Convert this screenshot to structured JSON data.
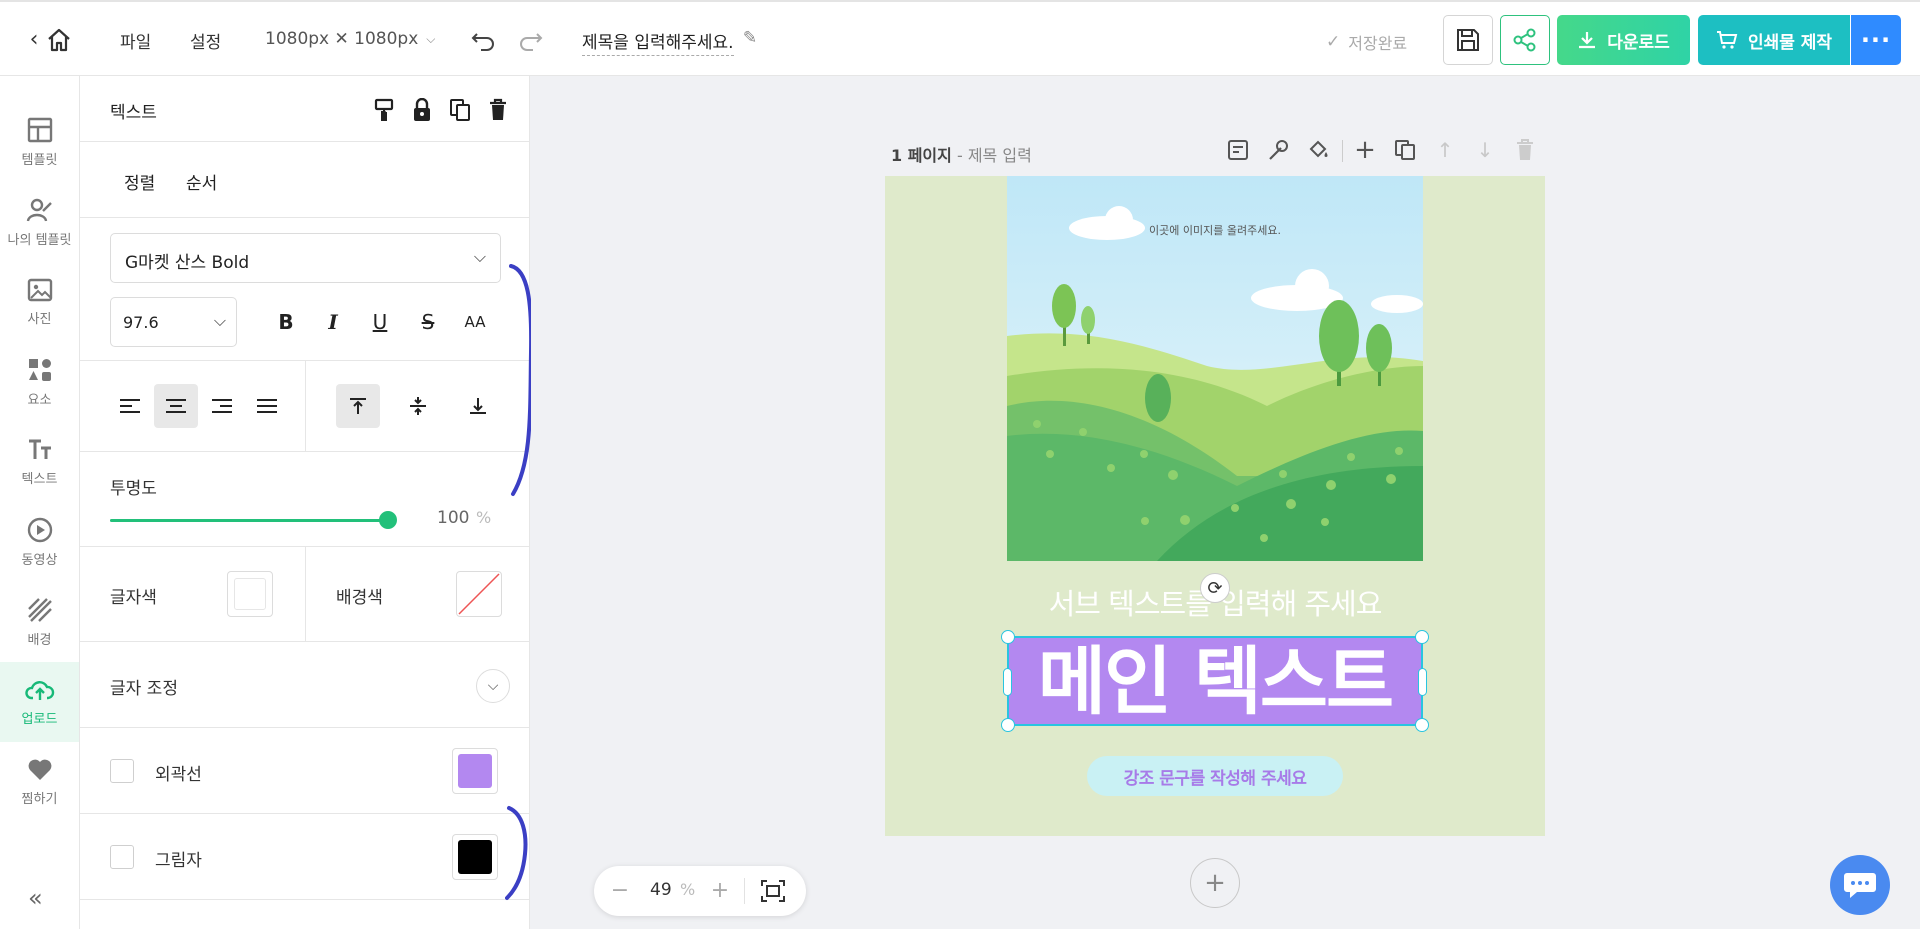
{
  "topbar": {
    "menu_file": "파일",
    "menu_settings": "설정",
    "size": "1080px ✕ 1080px",
    "title": "제목을 입력해주세요.",
    "save_status": "저장완료",
    "download_label": "다운로드",
    "print_label": "인쇄물 제작"
  },
  "leftnav": {
    "items": [
      {
        "label": "템플릿",
        "icon": "template-icon"
      },
      {
        "label": "나의 템플릿",
        "icon": "my-template-icon"
      },
      {
        "label": "사진",
        "icon": "photo-icon"
      },
      {
        "label": "요소",
        "icon": "elements-icon"
      },
      {
        "label": "텍스트",
        "icon": "text-icon"
      },
      {
        "label": "동영상",
        "icon": "video-icon"
      },
      {
        "label": "배경",
        "icon": "background-icon"
      },
      {
        "label": "업로드",
        "icon": "upload-icon"
      },
      {
        "label": "찜하기",
        "icon": "heart-icon"
      }
    ],
    "active": "업로드",
    "collapse": "«"
  },
  "panel": {
    "title": "텍스트",
    "tab_align": "정렬",
    "tab_order": "순서",
    "font": "G마켓 산스 Bold",
    "font_size": "97.6",
    "format_buttons": [
      "B",
      "I",
      "U",
      "S",
      "AA"
    ],
    "opacity_label": "투명도",
    "opacity_value": "100",
    "opacity_unit": "%",
    "opacity_fraction": 1.0,
    "text_color_label": "글자색",
    "bg_color_label": "배경색",
    "text_adjust_label": "글자 조정",
    "outline_label": "외곽선",
    "outline_color": "#b388f0",
    "shadow_label": "그림자",
    "shadow_color": "#000000"
  },
  "canvas": {
    "page_label": "1 페이지",
    "page_title_placeholder": " - 제목 입력",
    "image_placeholder": "이곳에 이미지를 올려주세요.",
    "sub_text": "서브 텍스트를 입력해 주세요",
    "main_text": "메인 텍스트",
    "emphasis_text": "강조 문구를 작성해 주세요",
    "zoom_value": "49",
    "zoom_unit": "%",
    "accent_purple": "#b388f0",
    "page_bg": "#dfeacb"
  },
  "colors": {
    "brand_green": "#2ec27e",
    "download_green": "#3ed69a",
    "print_teal": "#1dbfc2",
    "more_blue": "#2f8bff"
  }
}
